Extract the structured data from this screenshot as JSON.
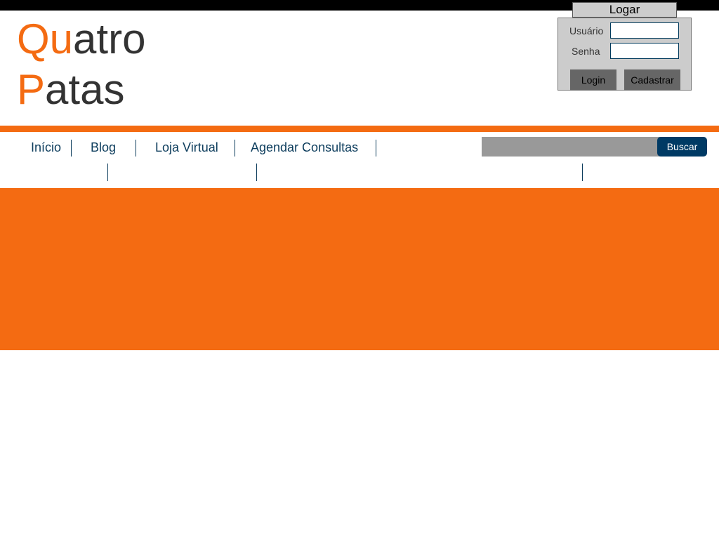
{
  "brand": {
    "line1_accent": "Qu",
    "line1_rest": "atro",
    "line2_accent": "P",
    "line2_rest": "atas"
  },
  "login": {
    "title": "Logar",
    "username_label": "Usuário",
    "password_label": "Senha",
    "username_value": "",
    "password_value": "",
    "login_button": "Login",
    "register_button": "Cadastrar"
  },
  "nav": {
    "items": [
      {
        "label": "Início"
      },
      {
        "label": "Blog"
      },
      {
        "label": "Loja Virtual"
      },
      {
        "label": "Agendar Consultas"
      }
    ]
  },
  "search": {
    "value": "",
    "button": "Buscar"
  },
  "colors": {
    "accent": "#f46b12",
    "nav_text": "#0c3c5c",
    "search_button": "#003a64",
    "login_panel": "#cccccc"
  }
}
